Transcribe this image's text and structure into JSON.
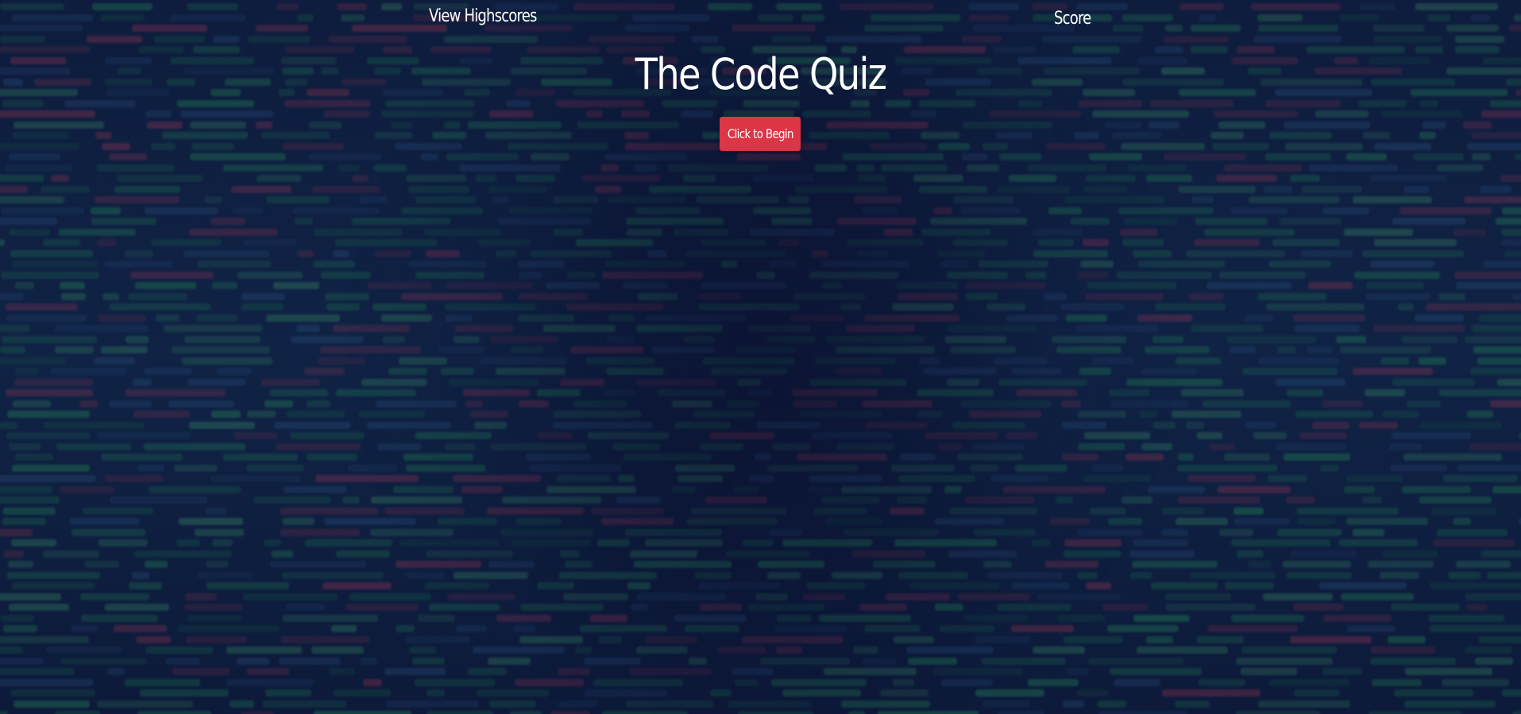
{
  "header": {
    "highscores_link": "View Highscores",
    "score_label": "Score",
    "score_value": ""
  },
  "main": {
    "title": "The Code Quiz",
    "start_button": "Click to Begin"
  },
  "colors": {
    "background": "#0d1a3a",
    "accent_button": "#dc3545",
    "text": "#ffffff"
  }
}
